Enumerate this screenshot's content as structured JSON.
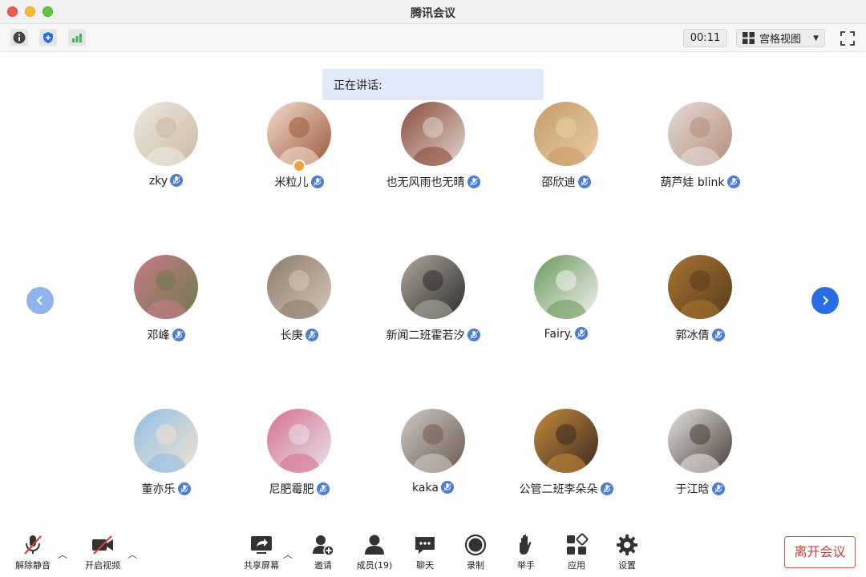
{
  "window": {
    "title": "腾讯会议"
  },
  "toolbar": {
    "timer": "00:11",
    "view_label": "宫格视图"
  },
  "speaking": {
    "label": "正在讲话:"
  },
  "participants": [
    {
      "name": "zky",
      "colors": [
        "#efe9e0",
        "#c9b9a3"
      ]
    },
    {
      "name": "米粒儿",
      "colors": [
        "#f4dccc",
        "#9a5a3b"
      ],
      "host": true
    },
    {
      "name": "也无风雨也无晴",
      "colors": [
        "#8b4a3a",
        "#e0d6cf"
      ]
    },
    {
      "name": "邵欣迪",
      "colors": [
        "#c69a68",
        "#e8cfa5"
      ]
    },
    {
      "name": "葫芦娃 blink",
      "colors": [
        "#e5dcd6",
        "#b58d7d"
      ]
    },
    {
      "name": "邓峰",
      "colors": [
        "#c97a8a",
        "#6d7a4d"
      ]
    },
    {
      "name": "长庚",
      "colors": [
        "#8c7b6a",
        "#d3c8ba"
      ]
    },
    {
      "name": "新闻二班霍若汐",
      "colors": [
        "#b0a99f",
        "#2d2a28"
      ]
    },
    {
      "name": "Fairy.",
      "colors": [
        "#6a9a5a",
        "#f2f2f2"
      ]
    },
    {
      "name": "郭冰倩",
      "colors": [
        "#a77630",
        "#5a3b1f"
      ]
    },
    {
      "name": "董亦乐",
      "colors": [
        "#8dbfe6",
        "#f3e2cf"
      ]
    },
    {
      "name": "尼肥霉肥",
      "colors": [
        "#d76f8c",
        "#e7e2ee"
      ]
    },
    {
      "name": "kaka",
      "colors": [
        "#cfc9c3",
        "#6a5b50"
      ]
    },
    {
      "name": "公管二班李朵朵",
      "colors": [
        "#c58a3b",
        "#3b2a20"
      ]
    },
    {
      "name": "于江晗",
      "colors": [
        "#e6e3e2",
        "#4a3c36"
      ]
    }
  ],
  "bottom": {
    "mute_label": "解除静音",
    "video_label": "开启视频",
    "share_label": "共享屏幕",
    "invite_label": "邀请",
    "members_label": "成员(19)",
    "chat_label": "聊天",
    "record_label": "录制",
    "raise_hand_label": "举手",
    "apps_label": "应用",
    "settings_label": "设置",
    "leave_label": "离开会议"
  },
  "colors": {
    "accent": "#2a6ee6",
    "leave": "#d23c37",
    "mic_badge": "#4a7dd6"
  }
}
